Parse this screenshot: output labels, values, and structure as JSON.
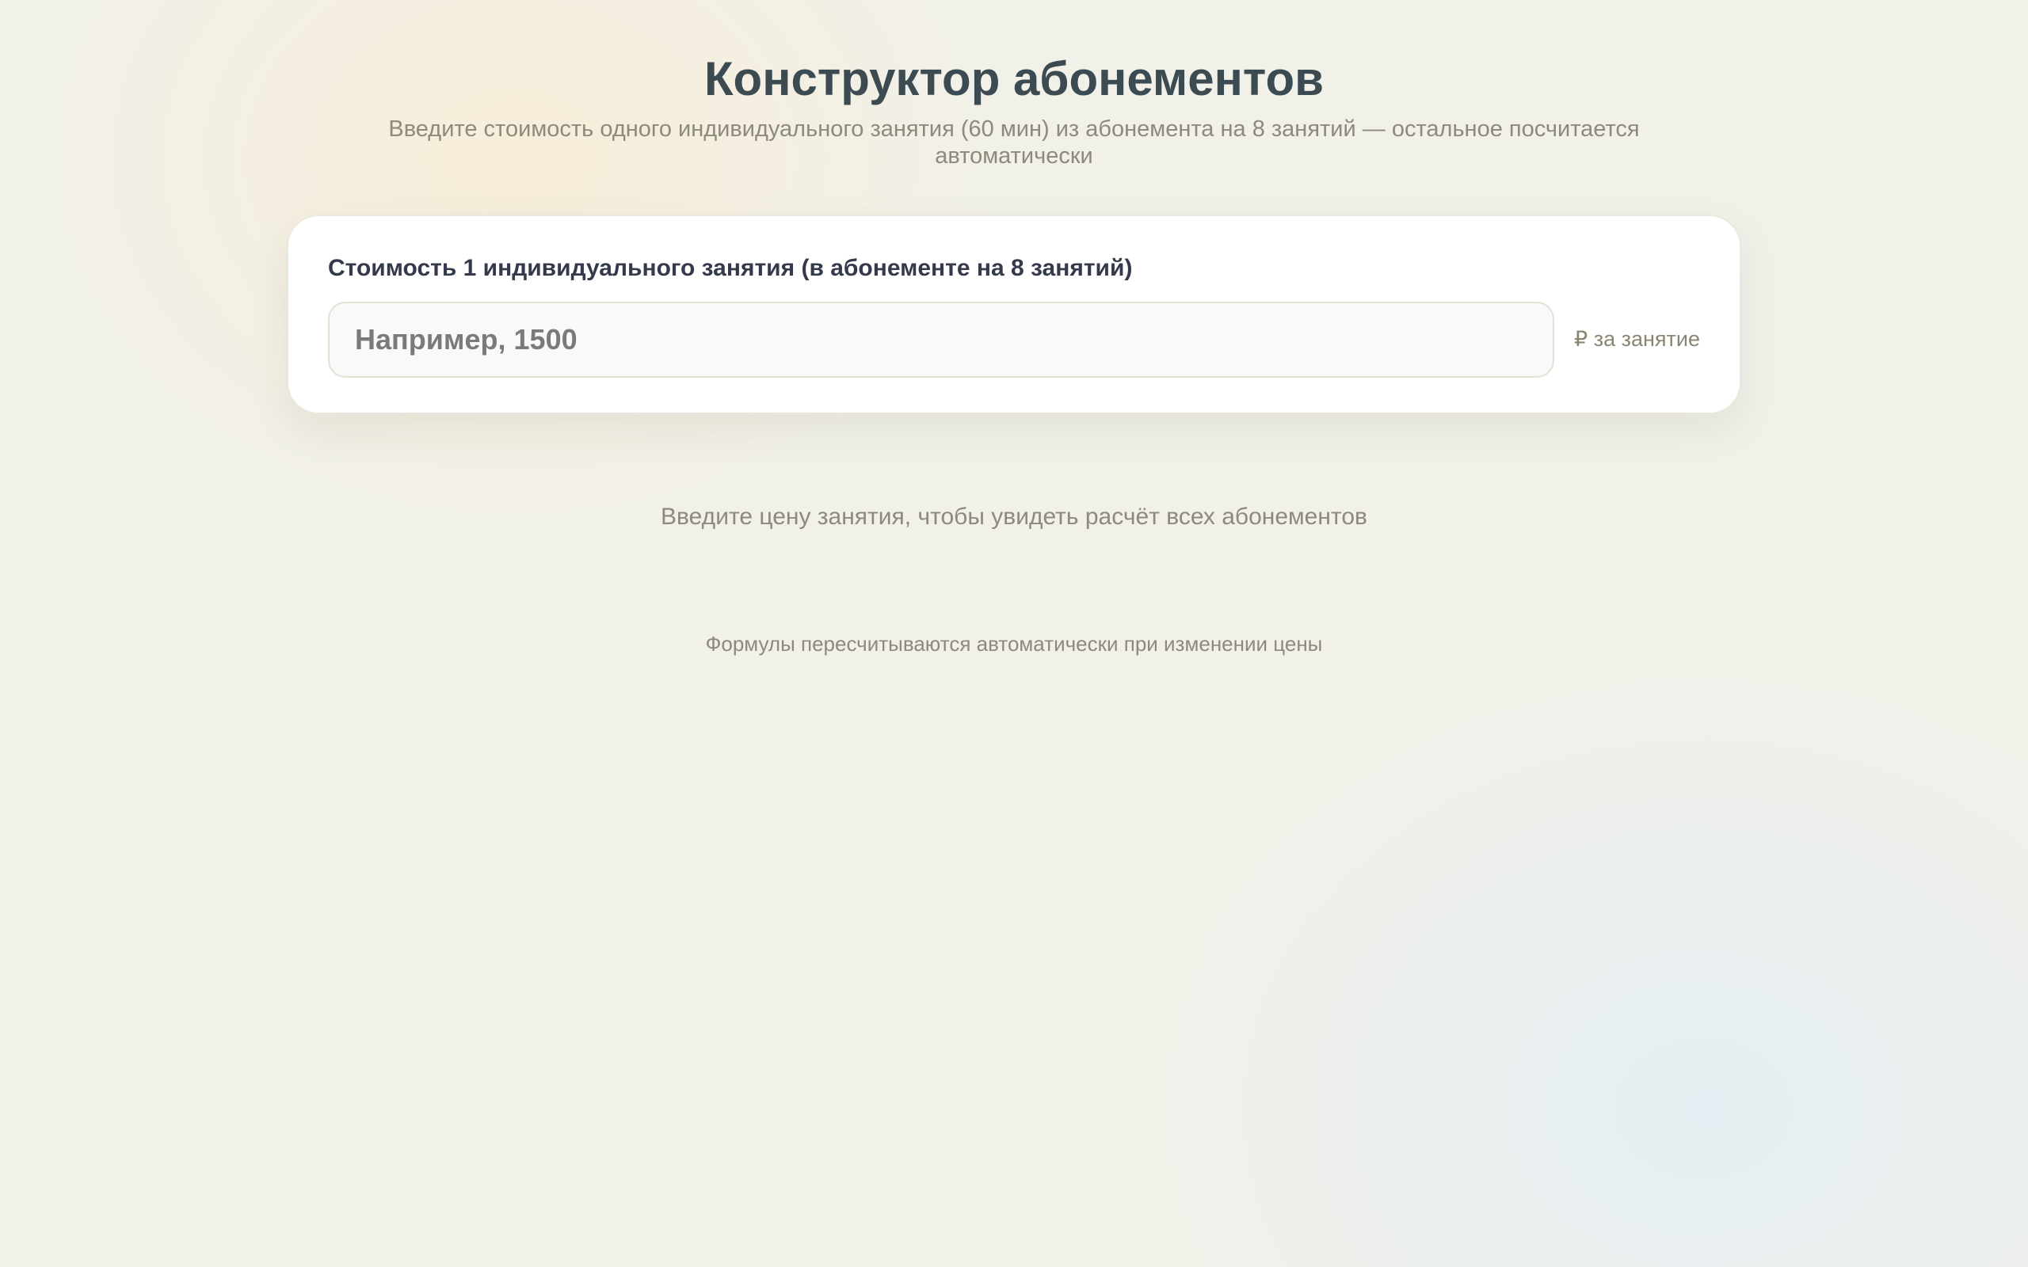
{
  "header": {
    "title": "Конструктор абонементов",
    "subtitle": "Введите стоимость одного индивидуального занятия (60 мин) из абонемента на 8 занятий — остальное посчитается автоматически"
  },
  "price_card": {
    "label": "Стоимость 1 индивидуального занятия (в абонементе на 8 занятий)",
    "input_value": "",
    "input_placeholder": "Например, 1500",
    "unit": "₽ за занятие"
  },
  "results": {
    "empty_hint": "Введите цену занятия, чтобы увидеть расчёт всех абонементов"
  },
  "footer": {
    "note": "Формулы пересчитываются автоматически при изменении цены"
  },
  "colors": {
    "title": "#3c4a52",
    "muted_text": "#8d8a7c",
    "card_background": "#ffffff",
    "input_background": "#f9f9fa"
  }
}
